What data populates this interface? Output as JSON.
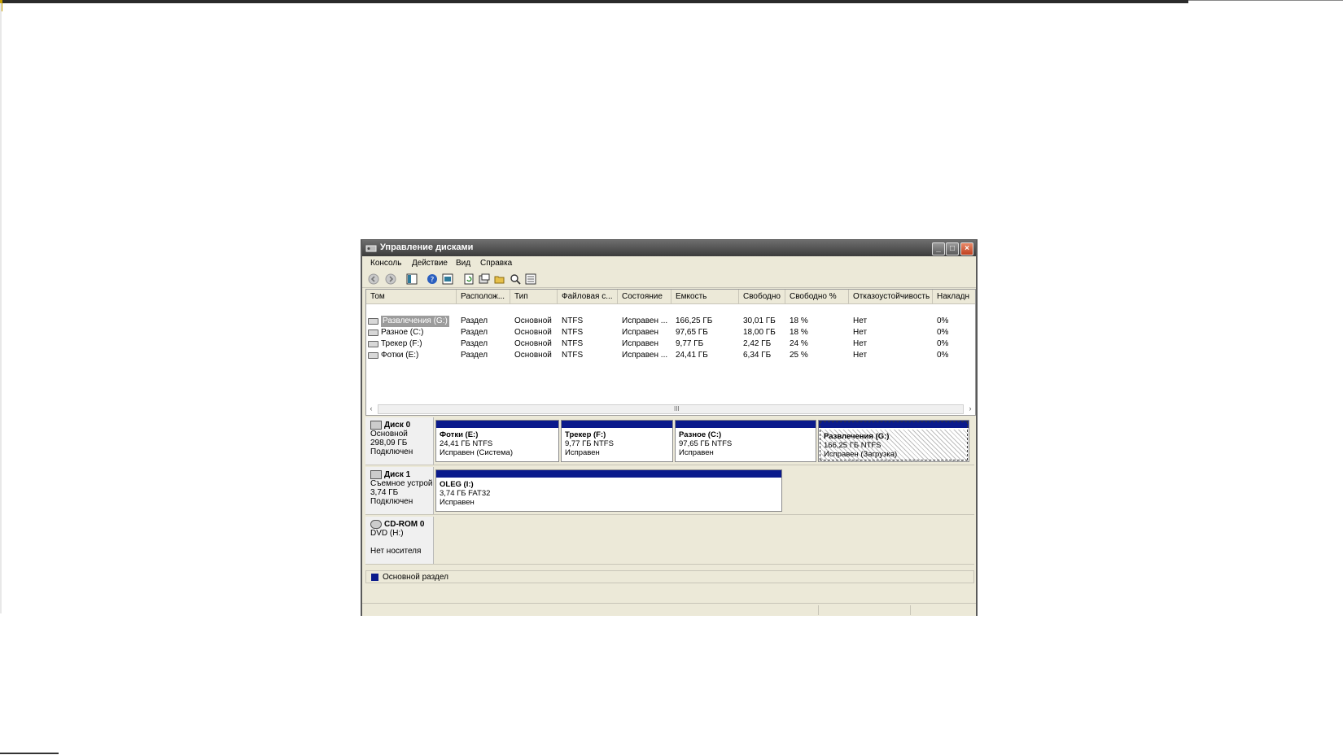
{
  "window": {
    "title": "Управление дисками"
  },
  "menu": [
    "Консоль",
    "Действие",
    "Вид",
    "Справка"
  ],
  "columns": [
    "Том",
    "Располож...",
    "Тип",
    "Файловая с...",
    "Состояние",
    "Емкость",
    "Свободно",
    "Свободно %",
    "Отказоустойчивость",
    "Накладн"
  ],
  "volumes": [
    {
      "name": "Развлечения (G:)",
      "layout": "Раздел",
      "type": "Основной",
      "fs": "NTFS",
      "status": "Исправен ...",
      "capacity": "166,25 ГБ",
      "free": "30,01 ГБ",
      "free_pct": "18 %",
      "fault": "Нет",
      "overhead": "0%"
    },
    {
      "name": "Разное (C:)",
      "layout": "Раздел",
      "type": "Основной",
      "fs": "NTFS",
      "status": "Исправен",
      "capacity": "97,65 ГБ",
      "free": "18,00 ГБ",
      "free_pct": "18 %",
      "fault": "Нет",
      "overhead": "0%"
    },
    {
      "name": "Трекер (F:)",
      "layout": "Раздел",
      "type": "Основной",
      "fs": "NTFS",
      "status": "Исправен",
      "capacity": "9,77 ГБ",
      "free": "2,42 ГБ",
      "free_pct": "24 %",
      "fault": "Нет",
      "overhead": "0%"
    },
    {
      "name": "Фотки (E:)",
      "layout": "Раздел",
      "type": "Основной",
      "fs": "NTFS",
      "status": "Исправен ...",
      "capacity": "24,41 ГБ",
      "free": "6,34 ГБ",
      "free_pct": "25 %",
      "fault": "Нет",
      "overhead": "0%"
    }
  ],
  "scroll": {
    "grip": "III"
  },
  "disks": [
    {
      "name": "Диск 0",
      "type": "Основной",
      "size": "298,09 ГБ",
      "state": "Подключен",
      "partitions": [
        {
          "name": "Фотки (E:)",
          "size": "24,41 ГБ NTFS",
          "status": "Исправен (Система)"
        },
        {
          "name": "Трекер (F:)",
          "size": "9,77 ГБ NTFS",
          "status": "Исправен"
        },
        {
          "name": "Разное (C:)",
          "size": "97,65 ГБ NTFS",
          "status": "Исправен"
        },
        {
          "name": "Развлечения (G:)",
          "size": "166,25 ГБ NTFS",
          "status": "Исправен (Загрузка)"
        }
      ]
    },
    {
      "name": "Диск 1",
      "type": "Съемное устрой",
      "size": "3,74 ГБ",
      "state": "Подключен",
      "partitions": [
        {
          "name": "OLEG (I:)",
          "size": "3,74 ГБ FAT32",
          "status": "Исправен"
        }
      ]
    },
    {
      "name": "CD-ROM 0",
      "type": "DVD (H:)",
      "state": "Нет носителя"
    }
  ],
  "legend": {
    "primary_label": "Основной раздел",
    "primary_color": "#0a1a8c"
  },
  "icons": [
    "back-icon",
    "forward-icon",
    "show-hide-tree-icon",
    "help-icon",
    "export-icon",
    "refresh-icon",
    "properties-icon",
    "open-icon",
    "explore-icon",
    "settings-icon"
  ]
}
